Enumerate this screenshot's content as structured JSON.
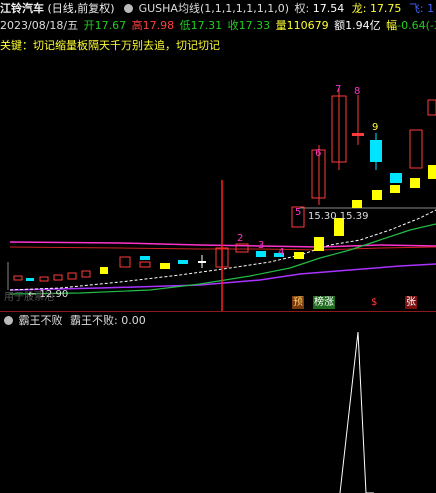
{
  "header": {
    "stock_name": "江铃汽车",
    "period": "(日线,前复权)",
    "indicator_name": "GUSHA均线(1,1,1,1,1,1,1,0)",
    "quan_label": "权:",
    "quan_value": "17.54",
    "long_label": "龙:",
    "long_value": "17.75",
    "fei_label": "飞:",
    "fei_value": "1"
  },
  "quote": {
    "date": "2023/08/18/五",
    "open_label": "开",
    "open": "17.67",
    "high_label": "高",
    "high": "17.98",
    "low_label": "低",
    "low": "17.31",
    "close_label": "收",
    "close": "17.33",
    "volume_label": "量",
    "volume": "110679",
    "amount_label": "额",
    "amount": "1.94亿",
    "change_label": "幅",
    "change": "-0.64(-3"
  },
  "note": "关键：切记缩量板隔天千万别去追，切记切记",
  "chart_labels": {
    "low_marker": "← 12.90",
    "mid_value": "15.30  15.39",
    "faded_text": "用于股票池",
    "numbers": [
      "2",
      "3",
      "4",
      "5",
      "6",
      "7",
      "8",
      "9"
    ]
  },
  "badges": [
    {
      "text": "预",
      "bg": "#7a3a10",
      "fg": "#ffcc66"
    },
    {
      "text": "榜涨",
      "bg": "#1f6b1f",
      "fg": "#ffffff"
    },
    {
      "text": "$",
      "bg": "#000000",
      "fg": "#ff4040"
    },
    {
      "text": "张",
      "bg": "#7a1010",
      "fg": "#ffffff"
    }
  ],
  "sub_panel": {
    "name": "霸王不败",
    "line_label": "霸王不败:",
    "line_value": "0.00"
  },
  "colors": {
    "up": "#ff3b3b",
    "down": "#00e5ff",
    "signal_candle": "#ffff00",
    "cursor": "#ff2020",
    "ma_long": "#aa33ff",
    "ma_mid": "#22bb44",
    "ma_magenta": "#ff33cc"
  }
}
